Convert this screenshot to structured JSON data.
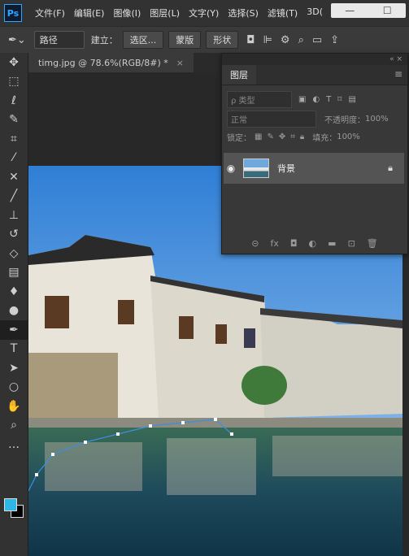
{
  "app_logo": "Ps",
  "menu": [
    "文件(F)",
    "编辑(E)",
    "图像(I)",
    "图层(L)",
    "文字(Y)",
    "选择(S)",
    "滤镜(T)",
    "3D("
  ],
  "options_bar": {
    "mode_select": "路径",
    "make_label": "建立：",
    "selection_button": "选区...",
    "mask_button": "蒙版",
    "shape_button": "形状"
  },
  "document_tab": {
    "title": "timg.jpg @ 78.6%(RGB/8#) *",
    "close": "×"
  },
  "tools": [
    "move-icon",
    "marquee-icon",
    "lasso-icon",
    "quick-select-icon",
    "crop-icon",
    "eyedropper-icon",
    "healing-icon",
    "brush-icon",
    "stamp-icon",
    "history-brush-icon",
    "eraser-icon",
    "gradient-icon",
    "blur-icon",
    "dodge-icon",
    "pen-icon",
    "type-icon",
    "path-select-icon",
    "ellipse-icon",
    "hand-icon",
    "zoom-icon",
    "more-icon"
  ],
  "colors": {
    "foreground": "#2fb5e6",
    "background": "#000000",
    "accent": "#31a8ff"
  },
  "layers_panel": {
    "title": "图层",
    "filter_kind": "ρ 类型",
    "blend_mode": "正常",
    "opacity_label": "不透明度：",
    "opacity_value": "100%",
    "lock_label": "锁定：",
    "fill_label": "填充：",
    "fill_value": "100%",
    "layers": [
      {
        "name": "背景",
        "visible": true,
        "locked": true
      }
    ]
  }
}
